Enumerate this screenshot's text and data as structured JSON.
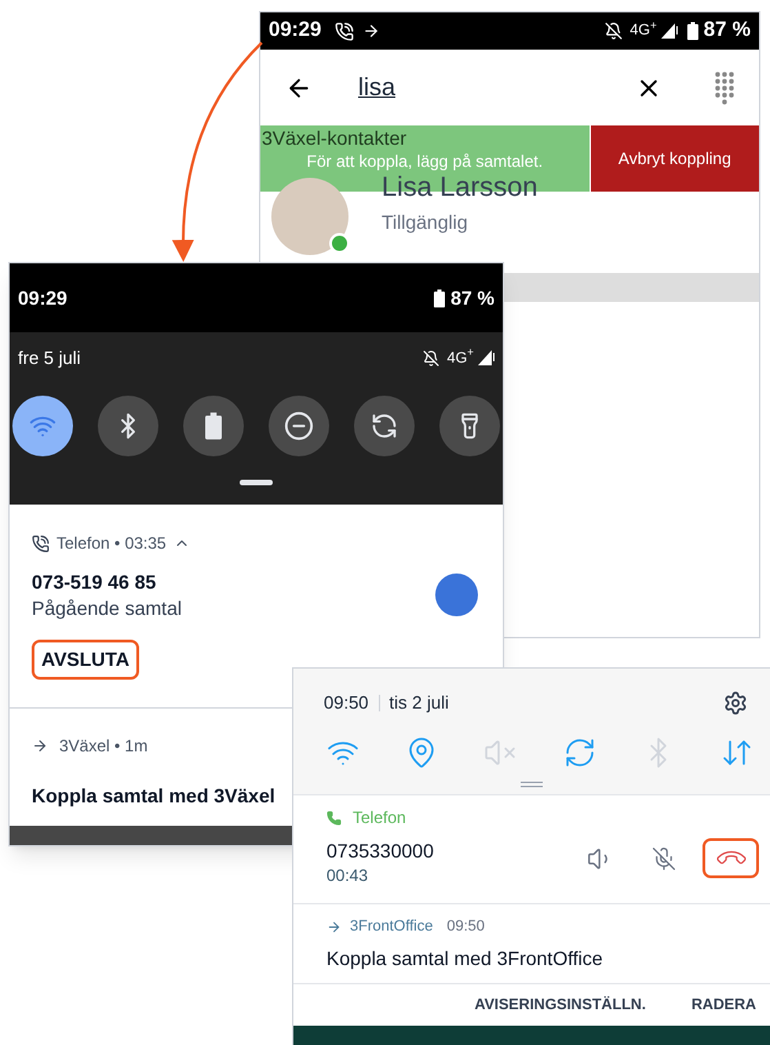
{
  "contact_search": {
    "status_bar": {
      "time": "09:29",
      "network": "4G$^{+}$",
      "battery": "87 %"
    },
    "search": {
      "value": "lisa"
    },
    "section_header": "3Växel-kontakter",
    "banner": {
      "message": "För att koppla, lägg på samtalet.",
      "cancel_button": "Avbryt koppling"
    },
    "contacts": [
      {
        "name": "Lisa Larsson",
        "status": "Tillgänglig",
        "available": true
      }
    ]
  },
  "android_shade": {
    "status_bar": {
      "time": "09:29",
      "battery": "87 %"
    },
    "date": "fre 5 juli",
    "network": "4G$^{+}$",
    "tiles": [
      {
        "kind": "wifi",
        "on": true
      },
      {
        "kind": "bluetooth",
        "on": false
      },
      {
        "kind": "battery",
        "on": false
      },
      {
        "kind": "dnd",
        "on": false
      },
      {
        "kind": "rotate",
        "on": false
      },
      {
        "kind": "flashlight",
        "on": false
      }
    ],
    "notifications": [
      {
        "kind": "call",
        "header": "Telefon • 03:35",
        "title": "073-519 46 85",
        "text": "Pågående samtal",
        "action": "AVSLUTA",
        "highlighted": true
      },
      {
        "kind": "message",
        "header": "3Växel • 1m",
        "title": "Koppla samtal med 3Växel"
      }
    ]
  },
  "samsung_shade": {
    "time": "09:50",
    "date": "tis 2 juli",
    "toggles": [
      {
        "kind": "wifi",
        "on": true
      },
      {
        "kind": "location",
        "on": true
      },
      {
        "kind": "sound",
        "on": false
      },
      {
        "kind": "rotate",
        "on": true
      },
      {
        "kind": "bluetooth",
        "on": false
      },
      {
        "kind": "data",
        "on": true
      }
    ],
    "call": {
      "app": "Telefon",
      "number": "0735330000",
      "duration": "00:43",
      "end_highlighted": true
    },
    "message": {
      "app": "3FrontOffice",
      "time": "09:50",
      "text": "Koppla samtal med 3FrontOffice"
    },
    "buttons": [
      "AVISERINGSINSTÄLLN.",
      "RADERA"
    ]
  }
}
